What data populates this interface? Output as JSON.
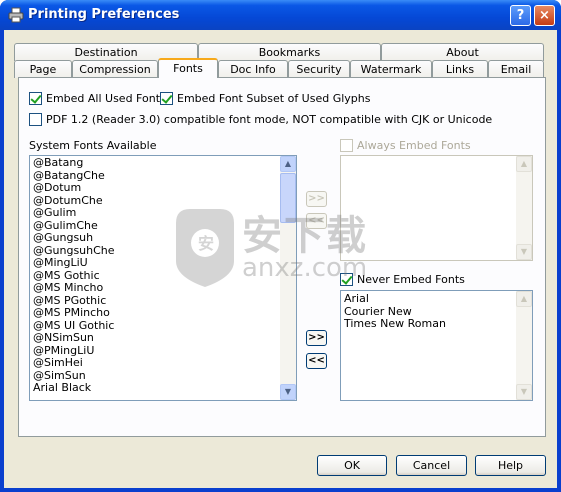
{
  "window": {
    "title": "Printing Preferences",
    "help_label": "?",
    "close_label": "×"
  },
  "tabs": {
    "row1": [
      "Destination",
      "Bookmarks",
      "About"
    ],
    "row2": [
      "Page",
      "Compression",
      "Fonts",
      "Doc Info",
      "Security",
      "Watermark",
      "Links",
      "Email"
    ],
    "active": "Fonts"
  },
  "fonts": {
    "embed_all_label": "Embed All Used Fonts",
    "embed_all_checked": true,
    "embed_subset_label": "Embed Font Subset of Used Glyphs",
    "embed_subset_checked": true,
    "pdf12_label": "PDF 1.2 (Reader 3.0) compatible font mode, NOT compatible with CJK or Unicode",
    "pdf12_checked": false,
    "system_fonts_label": "System Fonts Available",
    "system_fonts": [
      "@Batang",
      "@BatangChe",
      "@Dotum",
      "@DotumChe",
      "@Gulim",
      "@GulimChe",
      "@Gungsuh",
      "@GungsuhChe",
      "@MingLiU",
      "@MS Gothic",
      "@MS Mincho",
      "@MS PGothic",
      "@MS PMincho",
      "@MS UI Gothic",
      "@NSimSun",
      "@PMingLiU",
      "@SimHei",
      "@SimSun",
      "Arial Black"
    ],
    "always_embed_label": "Always Embed Fonts",
    "always_embed_checked": false,
    "never_embed_label": "Never Embed Fonts",
    "never_embed_checked": true,
    "never_embed_fonts": [
      "Arial",
      "Courier New",
      "Times New Roman"
    ],
    "move_right_label": ">>",
    "move_left_label": "<<"
  },
  "footer": {
    "ok_label": "OK",
    "cancel_label": "Cancel",
    "help_label": "Help"
  },
  "watermark": {
    "text_cn": "安下载",
    "text_en": "anxz.com"
  },
  "colors": {
    "titlebar": "#0548d6",
    "dialog_bg": "#ece9d8",
    "active_tab_accent": "#f7a91b",
    "check_mark": "#21a121"
  }
}
